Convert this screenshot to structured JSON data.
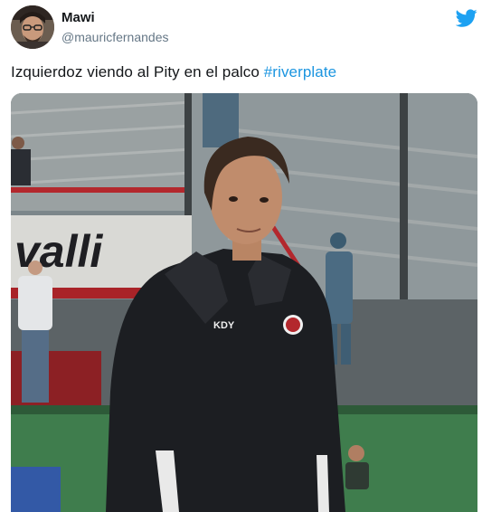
{
  "user": {
    "display_name": "Mawi",
    "handle": "@mauricfernandes"
  },
  "tweet": {
    "text": "Izquierdoz viendo al Pity en el palco ",
    "hashtag": "#riverplate"
  },
  "media": {
    "banner_text": "valli",
    "jacket_brand": "KDY"
  },
  "icons": {
    "platform": "twitter-bird-icon"
  },
  "colors": {
    "hashtag": "#1b95e0",
    "twitter_blue": "#1da1f2",
    "name": "#14171a",
    "handle": "#657786"
  }
}
